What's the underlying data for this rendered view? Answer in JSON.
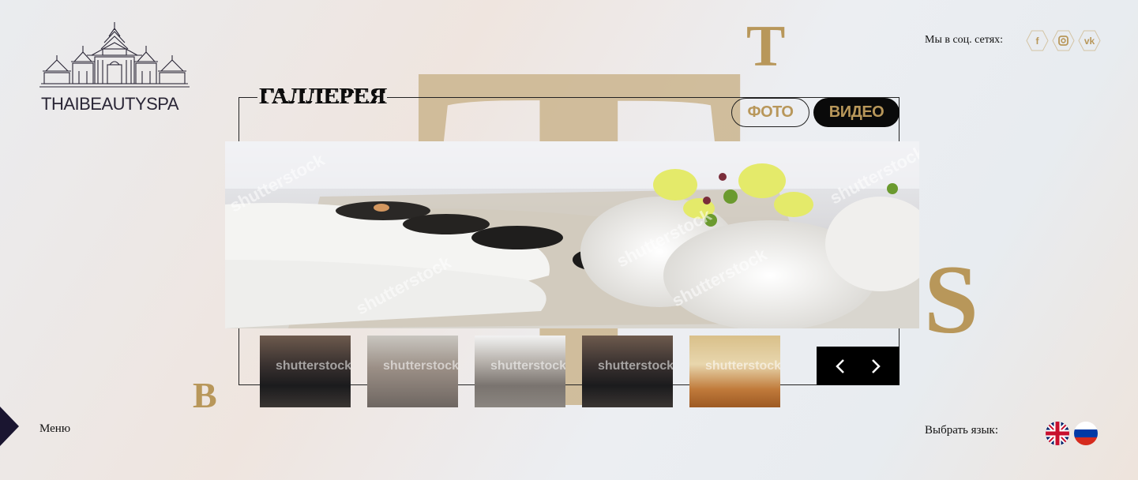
{
  "brand": {
    "logo_text": "THAIBEAUTYSPA"
  },
  "deco_letters": {
    "big": "T",
    "t_small": "T",
    "s": "S",
    "b": "B"
  },
  "social": {
    "label": "Мы в соц. сетях:",
    "icons": [
      {
        "name": "facebook-icon",
        "glyph": "f"
      },
      {
        "name": "instagram-icon",
        "glyph": "◘"
      },
      {
        "name": "vk-icon",
        "glyph": "vk"
      }
    ]
  },
  "gallery": {
    "title": "ГАЛЛЕРЕЯ",
    "tabs": {
      "photo": "ФОТО",
      "video": "ВИДЕО"
    },
    "watermark": "shutterstock"
  },
  "menu": {
    "label": "Меню"
  },
  "language": {
    "label": "Выбрать язык:"
  },
  "colors": {
    "gold": "#b8975a",
    "dark": "#0a0a0a",
    "navy": "#1a1530"
  }
}
